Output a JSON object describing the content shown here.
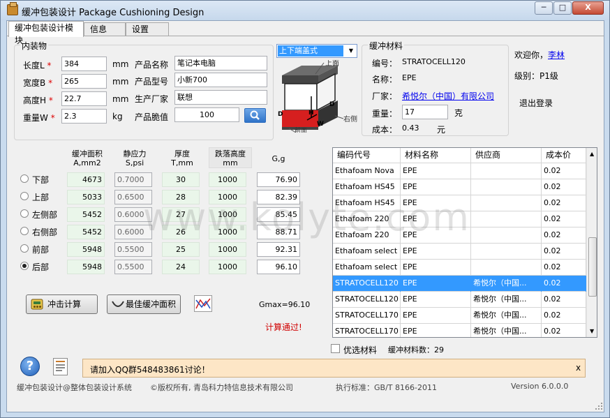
{
  "window": {
    "title": "缓冲包装设计 Package Cushioning Design",
    "controls": {
      "minimize": "─",
      "maximize": "□",
      "close": "X"
    }
  },
  "tabs": [
    {
      "label": "缓冲包装设计模块",
      "active": true
    },
    {
      "label": "信息",
      "active": false
    },
    {
      "label": "设置",
      "active": false
    }
  ],
  "contents": {
    "group_title": "内装物",
    "length_label": "长度L",
    "length_value": "384",
    "width_label": "宽度B",
    "width_value": "265",
    "height_label": "高度H",
    "height_value": "22.7",
    "weight_label": "重量W",
    "weight_value": "2.3",
    "unit_mm": "mm",
    "unit_kg": "kg",
    "required_mark": "*",
    "product_name_label": "产品名称",
    "product_name_value": "笔记本电脑",
    "product_model_label": "产品型号",
    "product_model_value": "小新700",
    "manufacturer_label": "生产厂家",
    "manufacturer_value": "联想",
    "fragility_label": "产品脆值",
    "fragility_value": "100"
  },
  "packaging_type": {
    "selected": "上下端盖式",
    "diagram_labels": {
      "top": "上面",
      "right": "右侧",
      "front": "前面",
      "h": "H",
      "w": "W",
      "d": "D",
      "d2": "D"
    }
  },
  "material": {
    "group_title": "缓冲材料",
    "code_label": "编号：",
    "code_value": "STRATOCELL120",
    "name_label": "名称：",
    "name_value": "EPE",
    "vendor_label": "厂家：",
    "vendor_value": "希悦尔（中国）有限公司",
    "weight_label": "重量：",
    "weight_value": "17",
    "weight_unit": "克",
    "cost_label": "成本：",
    "cost_value": "0.43",
    "cost_unit": "元"
  },
  "user": {
    "welcome": "欢迎你，",
    "name": "李林",
    "level_label": "级别：",
    "level_value": "P1级",
    "logout": "退出登录"
  },
  "calc": {
    "headers": {
      "area": "缓冲面积",
      "area_unit": "A,mm2",
      "stress": "静应力",
      "stress_unit": "S,psi",
      "thickness": "厚度",
      "thickness_unit": "T,mm",
      "drop": "跌落高度",
      "drop_unit": "mm",
      "g": "G,g"
    },
    "rows": [
      {
        "label": "下部",
        "selected": false,
        "area": "4673",
        "stress": "0.7000",
        "thickness": "30",
        "drop": "1000",
        "g": "76.90"
      },
      {
        "label": "上部",
        "selected": false,
        "area": "5033",
        "stress": "0.6500",
        "thickness": "28",
        "drop": "1000",
        "g": "82.39"
      },
      {
        "label": "左侧部",
        "selected": false,
        "area": "5452",
        "stress": "0.6000",
        "thickness": "27",
        "drop": "1000",
        "g": "85.45"
      },
      {
        "label": "右侧部",
        "selected": false,
        "area": "5452",
        "stress": "0.6000",
        "thickness": "26",
        "drop": "1000",
        "g": "88.71"
      },
      {
        "label": "前部",
        "selected": false,
        "area": "5948",
        "stress": "0.5500",
        "thickness": "25",
        "drop": "1000",
        "g": "92.31"
      },
      {
        "label": "后部",
        "selected": true,
        "area": "5948",
        "stress": "0.5500",
        "thickness": "24",
        "drop": "1000",
        "g": "96.10"
      }
    ],
    "impact_button": "冲击计算",
    "best_area_button": "最佳缓冲面积",
    "gmax": "Gmax=96.10",
    "result": "计算通过!"
  },
  "materials_table": {
    "columns": [
      "编码代号",
      "材料名称",
      "供应商",
      "成本价"
    ],
    "rows": [
      {
        "code": "Ethafoam Nova",
        "name": "EPE",
        "vendor": "",
        "cost": "0.02",
        "selected": false
      },
      {
        "code": "Ethafoam HS45",
        "name": "EPE",
        "vendor": "",
        "cost": "0.02",
        "selected": false
      },
      {
        "code": "Ethafoam HS45",
        "name": "EPE",
        "vendor": "",
        "cost": "0.02",
        "selected": false
      },
      {
        "code": "Ethafoam 220",
        "name": "EPE",
        "vendor": "",
        "cost": "0.02",
        "selected": false
      },
      {
        "code": "Ethafoam 220",
        "name": "EPE",
        "vendor": "",
        "cost": "0.02",
        "selected": false
      },
      {
        "code": "Ethafoam select",
        "name": "EPE",
        "vendor": "",
        "cost": "0.02",
        "selected": false
      },
      {
        "code": "Ethafoam select",
        "name": "EPE",
        "vendor": "",
        "cost": "0.02",
        "selected": false
      },
      {
        "code": "STRATOCELL120",
        "name": "EPE",
        "vendor": "希悦尔（中国...",
        "cost": "0.02",
        "selected": true
      },
      {
        "code": "STRATOCELL120",
        "name": "EPE",
        "vendor": "希悦尔（中国...",
        "cost": "0.02",
        "selected": false
      },
      {
        "code": "STRATOCELL170",
        "name": "EPE",
        "vendor": "希悦尔（中国...",
        "cost": "0.02",
        "selected": false
      },
      {
        "code": "STRATOCELL170",
        "name": "EPE",
        "vendor": "希悦尔（中国...",
        "cost": "0.02",
        "selected": false
      }
    ],
    "preferred_label": "优选材料",
    "count_label": "缓冲材料数：",
    "count_value": "29"
  },
  "notice": {
    "text": "请加入QQ群548483861讨论！",
    "close": "x"
  },
  "footer": {
    "product": "缓冲包装设计@整体包装设计系统",
    "copyright": "©版权所有, 青岛科力特信息技术有限公司",
    "standard": "执行标准：GB/T 8166-2011",
    "version": "Version 6.0.0.0"
  },
  "watermark": "www.kolyte.com",
  "colors": {
    "accent": "#3399ff",
    "result_red": "#d00000",
    "notice_bg": "#fde6c6"
  }
}
